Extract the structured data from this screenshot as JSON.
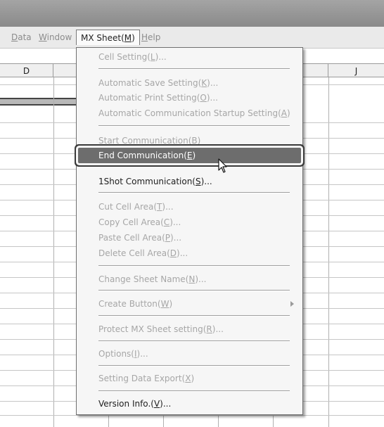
{
  "menubar": {
    "data": {
      "pre": "",
      "u": "D",
      "post": "ata"
    },
    "window": {
      "pre": "",
      "u": "W",
      "post": "indow"
    },
    "mxsheet": {
      "pre": "MX Sheet(",
      "u": "M",
      "post": ")"
    },
    "help": {
      "pre": "",
      "u": "H",
      "post": "elp"
    }
  },
  "columns": {
    "d": "D",
    "j": "J"
  },
  "menu": {
    "cell_setting": {
      "pre": "Cell Setting(",
      "u": "L",
      "post": ")..."
    },
    "auto_save": {
      "pre": "Automatic Save Setting(",
      "u": "K",
      "post": ")..."
    },
    "auto_print": {
      "pre": "Automatic Print Setting(",
      "u": "O",
      "post": ")..."
    },
    "auto_comm": {
      "pre": "Automatic Communication Startup Setting(",
      "u": "A",
      "post": ")"
    },
    "start_comm": {
      "pre": "Start Communication(",
      "u": "B",
      "post": ")"
    },
    "end_comm": {
      "pre": "End Communication(",
      "u": "E",
      "post": ")"
    },
    "oneshot": {
      "pre": "1Shot Communication(",
      "u": "S",
      "post": ")..."
    },
    "cut": {
      "pre": "Cut Cell Area(",
      "u": "T",
      "post": ")..."
    },
    "copy": {
      "pre": "Copy Cell Area(",
      "u": "C",
      "post": ")..."
    },
    "paste": {
      "pre": "Paste Cell Area(",
      "u": "P",
      "post": ")..."
    },
    "delete": {
      "pre": "Delete Cell Area(",
      "u": "D",
      "post": ")..."
    },
    "rename": {
      "pre": "Change Sheet Name(",
      "u": "N",
      "post": ")..."
    },
    "create_button": {
      "pre": "Create Button(",
      "u": "W",
      "post": ")"
    },
    "protect": {
      "pre": "Protect MX Sheet setting(",
      "u": "R",
      "post": ")..."
    },
    "options": {
      "pre": "Options(",
      "u": "I",
      "post": ")..."
    },
    "export": {
      "pre": "Setting Data Export(",
      "u": "X",
      "post": ")"
    },
    "version": {
      "pre": "Version Info.(",
      "u": "V",
      "post": ")..."
    }
  },
  "icons": {
    "submenu_arrow": "triangle-right",
    "cursor": "mouse-pointer"
  }
}
